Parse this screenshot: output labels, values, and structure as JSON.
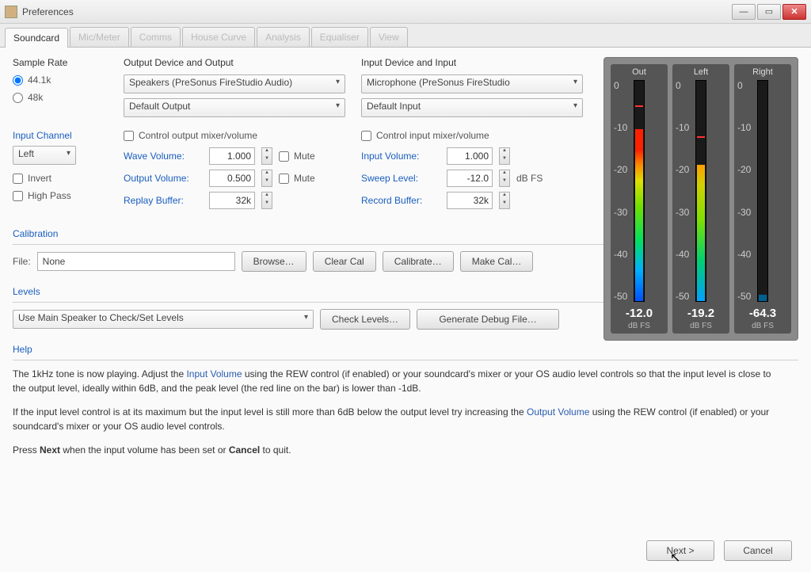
{
  "window": {
    "title": "Preferences"
  },
  "tabs": [
    "Soundcard",
    "Mic/Meter",
    "Comms",
    "House Curve",
    "Analysis",
    "Equaliser",
    "View"
  ],
  "sample_rate": {
    "label": "Sample Rate",
    "opt1": "44.1k",
    "opt2": "48k"
  },
  "output": {
    "heading": "Output Device and Output",
    "device": "Speakers (PreSonus FireStudio Audio)",
    "out": "Default Output",
    "cb": "Control output mixer/volume",
    "wave_l": "Wave Volume:",
    "wave_v": "1.000",
    "wave_mute": "Mute",
    "outv_l": "Output Volume:",
    "outv_v": "0.500",
    "outv_mute": "Mute",
    "buf_l": "Replay Buffer:",
    "buf_v": "32k"
  },
  "input": {
    "heading": "Input Device and Input",
    "device": "Microphone (PreSonus FireStudio",
    "in": "Default Input",
    "cb": "Control input mixer/volume",
    "inv_l": "Input Volume:",
    "inv_v": "1.000",
    "swp_l": "Sweep Level:",
    "swp_v": "-12.0",
    "swp_u": "dB FS",
    "buf_l": "Record Buffer:",
    "buf_v": "32k"
  },
  "channel": {
    "heading": "Input Channel",
    "value": "Left",
    "invert": "Invert",
    "hp": "High Pass"
  },
  "calibration": {
    "heading": "Calibration",
    "file_l": "File:",
    "file_v": "None",
    "browse": "Browse…",
    "clear": "Clear Cal",
    "calibrate": "Calibrate…",
    "make": "Make Cal…"
  },
  "levels": {
    "heading": "Levels",
    "sel": "Use Main Speaker to Check/Set Levels",
    "check": "Check Levels…",
    "debug": "Generate Debug File…"
  },
  "help": {
    "heading": "Help",
    "p1a": "The 1kHz tone is now playing. Adjust the ",
    "p1link1": "Input Volume",
    "p1b": " using the REW control (if enabled) or your soundcard's mixer or your OS audio level controls so that the input level is close to the output level, ideally within 6dB, and the peak level (the red line on the bar) is lower than -1dB.",
    "p2a": "If the input level control is at its maximum but the input level is still more than 6dB below the output level try increasing the ",
    "p2link": "Output Volume",
    "p2b": " using the REW control (if enabled) or your soundcard's mixer or your OS audio level controls.",
    "p3a": "Press ",
    "p3b": "Next",
    "p3c": " when the input volume has been set or ",
    "p3d": "Cancel",
    "p3e": " to quit."
  },
  "buttons": {
    "next": "Next >",
    "cancel": "Cancel"
  },
  "meters": {
    "ticks": [
      "0",
      "-10",
      "-20",
      "-30",
      "-40",
      "-50"
    ],
    "out": {
      "label": "Out",
      "value": "-12.0",
      "unit": "dB FS",
      "fill": 78,
      "peak": 88
    },
    "left": {
      "label": "Left",
      "value": "-19.2",
      "unit": "dB FS",
      "fill": 62,
      "peak": 74
    },
    "right": {
      "label": "Right",
      "value": "-64.3",
      "unit": "dB FS",
      "fill": 3,
      "peak": 0
    }
  }
}
